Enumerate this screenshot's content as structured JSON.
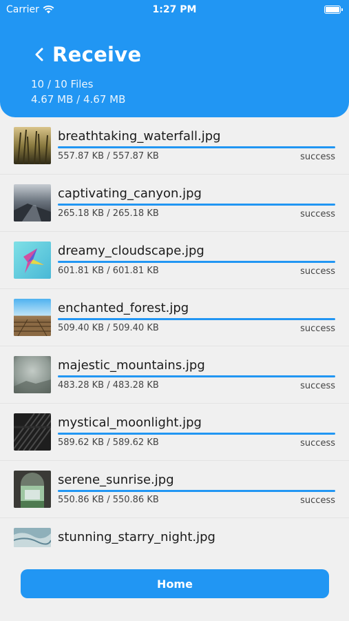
{
  "status_bar": {
    "carrier": "Carrier",
    "time": "1:27 PM"
  },
  "header": {
    "title": "Receive",
    "files_summary": "10 / 10 Files",
    "size_summary": "4.67 MB / 4.67 MB"
  },
  "files": [
    {
      "name": "breathtaking_waterfall.jpg",
      "size": "557.87 KB / 557.87 KB",
      "status": "success",
      "progress": 1.0
    },
    {
      "name": "captivating_canyon.jpg",
      "size": "265.18 KB / 265.18 KB",
      "status": "success",
      "progress": 1.0
    },
    {
      "name": "dreamy_cloudscape.jpg",
      "size": "601.81 KB / 601.81 KB",
      "status": "success",
      "progress": 1.0
    },
    {
      "name": "enchanted_forest.jpg",
      "size": "509.40 KB / 509.40 KB",
      "status": "success",
      "progress": 1.0
    },
    {
      "name": "majestic_mountains.jpg",
      "size": "483.28 KB / 483.28 KB",
      "status": "success",
      "progress": 1.0
    },
    {
      "name": "mystical_moonlight.jpg",
      "size": "589.62 KB / 589.62 KB",
      "status": "success",
      "progress": 1.0
    },
    {
      "name": "serene_sunrise.jpg",
      "size": "550.86 KB / 550.86 KB",
      "status": "success",
      "progress": 1.0
    },
    {
      "name": "stunning_starry_night.jpg"
    }
  ],
  "home_button": {
    "label": "Home"
  },
  "colors": {
    "accent": "#2196f3",
    "background": "#f0f0f0"
  }
}
